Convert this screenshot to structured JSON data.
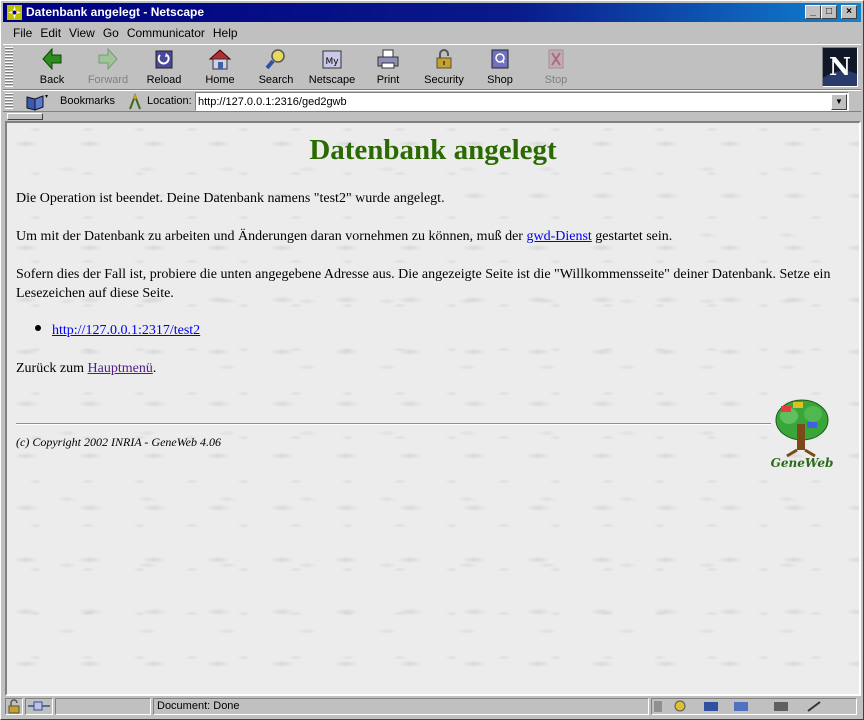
{
  "window": {
    "title": "Datenbank angelegt - Netscape"
  },
  "menu": {
    "items": [
      "File",
      "Edit",
      "View",
      "Go",
      "Communicator",
      "Help"
    ]
  },
  "toolbar": {
    "buttons": [
      {
        "label": "Back",
        "icon": "back-arrow-icon",
        "enabled": true
      },
      {
        "label": "Forward",
        "icon": "forward-arrow-icon",
        "enabled": false
      },
      {
        "label": "Reload",
        "icon": "reload-icon",
        "enabled": true
      },
      {
        "label": "Home",
        "icon": "home-icon",
        "enabled": true
      },
      {
        "label": "Search",
        "icon": "search-icon",
        "enabled": true
      },
      {
        "label": "Netscape",
        "icon": "netscape-icon",
        "enabled": true
      },
      {
        "label": "Print",
        "icon": "print-icon",
        "enabled": true
      },
      {
        "label": "Security",
        "icon": "security-lock-icon",
        "enabled": true
      },
      {
        "label": "Shop",
        "icon": "shop-icon",
        "enabled": true
      },
      {
        "label": "Stop",
        "icon": "stop-icon",
        "enabled": false
      }
    ]
  },
  "location": {
    "bookmarks_label": "Bookmarks",
    "location_label": "Location:",
    "url": "http://127.0.0.1:2316/ged2gwb"
  },
  "page": {
    "heading": "Datenbank angelegt",
    "p1": "Die Operation ist beendet. Deine Datenbank namens \"test2\" wurde angelegt.",
    "p2_before": "Um mit der Datenbank zu arbeiten und Änderungen daran vornehmen zu können, muß der ",
    "p2_link": "gwd-Dienst",
    "p2_after": " gestartet sein.",
    "p3": "Sofern dies der Fall ist, probiere die unten angegebene Adresse aus. Die angezeigte Seite ist die \"Willkommensseite\" deiner Datenbank. Setze ein Lesezeichen auf diese Seite.",
    "db_link": "http://127.0.0.1:2317/test2",
    "back_before": "Zurück zum ",
    "back_link": "Hauptmenü",
    "back_after": ".",
    "copyright": "(c) Copyright 2002 INRIA - GeneWeb 4.06",
    "logo_text": "GeneWeb"
  },
  "status": {
    "text": "Document: Done"
  },
  "colors": {
    "heading": "#2b6a00",
    "link": "#0000ee",
    "visited_link": "#551a8b",
    "titlebar": "#000080"
  }
}
